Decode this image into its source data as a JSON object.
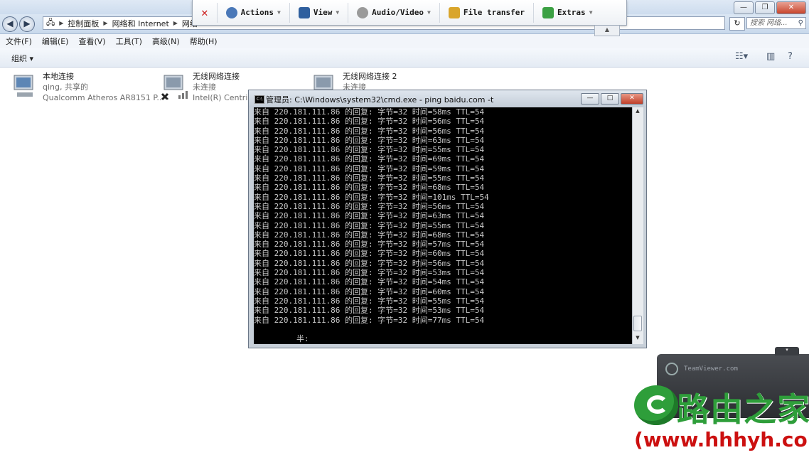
{
  "explorer": {
    "breadcrumbs": [
      "控制面板",
      "网络和 Internet",
      "网络"
    ],
    "search_placeholder": "搜索 网络...",
    "menu": [
      "文件(F)",
      "编辑(E)",
      "查看(V)",
      "工具(T)",
      "高级(N)",
      "帮助(H)"
    ],
    "organize_label": "组织 ▾",
    "adapters": [
      {
        "name": "本地连接",
        "status": "qing, 共享的",
        "device": "Qualcomm Atheros AR8151 P..."
      },
      {
        "name": "无线网络连接",
        "status": "未连接",
        "device": "Intel(R) Centrino"
      },
      {
        "name": "无线网络连接 2",
        "status": "未连接",
        "device": ""
      }
    ]
  },
  "teamviewer_toolbar": {
    "items": [
      {
        "label": "Actions",
        "icon": "gear-icon",
        "color": "#4a78b8"
      },
      {
        "label": "View",
        "icon": "monitor-icon",
        "color": "#2f5f9e"
      },
      {
        "label": "Audio/Video",
        "icon": "speaker-icon",
        "color": "#7a7a7a"
      },
      {
        "label": "File transfer",
        "icon": "folder-icon",
        "color": "#d9a52b"
      },
      {
        "label": "Extras",
        "icon": "puzzle-icon",
        "color": "#3ba043"
      }
    ]
  },
  "cmd": {
    "title": "管理员: C:\\Windows\\system32\\cmd.exe - ping  baidu.com -t",
    "lines": [
      "来自 220.181.111.86 的回复: 字节=32 时间=58ms TTL=54",
      "来自 220.181.111.86 的回复: 字节=32 时间=56ms TTL=54",
      "来自 220.181.111.86 的回复: 字节=32 时间=56ms TTL=54",
      "来自 220.181.111.86 的回复: 字节=32 时间=63ms TTL=54",
      "来自 220.181.111.86 的回复: 字节=32 时间=55ms TTL=54",
      "来自 220.181.111.86 的回复: 字节=32 时间=69ms TTL=54",
      "来自 220.181.111.86 的回复: 字节=32 时间=59ms TTL=54",
      "来自 220.181.111.86 的回复: 字节=32 时间=55ms TTL=54",
      "来自 220.181.111.86 的回复: 字节=32 时间=68ms TTL=54",
      "来自 220.181.111.86 的回复: 字节=32 时间=101ms TTL=54",
      "来自 220.181.111.86 的回复: 字节=32 时间=56ms TTL=54",
      "来自 220.181.111.86 的回复: 字节=32 时间=63ms TTL=54",
      "来自 220.181.111.86 的回复: 字节=32 时间=55ms TTL=54",
      "来自 220.181.111.86 的回复: 字节=32 时间=68ms TTL=54",
      "来自 220.181.111.86 的回复: 字节=32 时间=57ms TTL=54",
      "来自 220.181.111.86 的回复: 字节=32 时间=60ms TTL=54",
      "来自 220.181.111.86 的回复: 字节=32 时间=56ms TTL=54",
      "来自 220.181.111.86 的回复: 字节=32 时间=53ms TTL=54",
      "来自 220.181.111.86 的回复: 字节=32 时间=54ms TTL=54",
      "来自 220.181.111.86 的回复: 字节=32 时间=60ms TTL=54",
      "来自 220.181.111.86 的回复: 字节=32 时间=55ms TTL=54",
      "来自 220.181.111.86 的回复: 字节=32 时间=53ms TTL=54",
      "来自 220.181.111.86 的回复: 字节=32 时间=77ms TTL=54"
    ],
    "ime_text": "半:"
  },
  "teamviewer_panel": {
    "brand": "TeamViewer.com"
  },
  "watermark": {
    "chinese": "路由之家",
    "url": "(www.hhhyh.com)"
  }
}
